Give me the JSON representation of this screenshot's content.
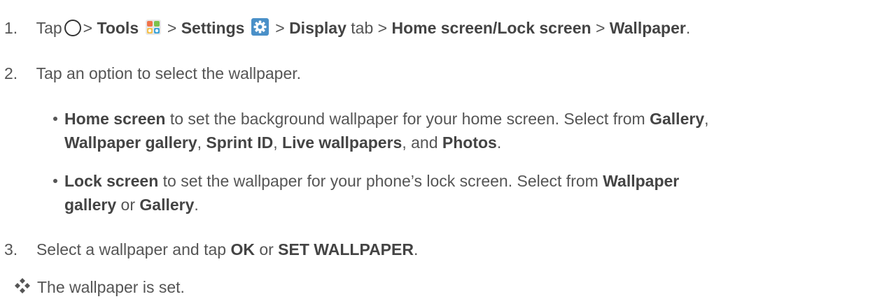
{
  "steps": [
    {
      "number": "1.",
      "parts": {
        "tap": "Tap",
        "sep1": ">",
        "tools": "Tools",
        "sep2": ">",
        "settings": "Settings",
        "sep3": ">",
        "display": "Display",
        "tab": "tab >",
        "home_lock": "Home screen/Lock screen",
        "sep4": ">",
        "wallpaper": "Wallpaper",
        "end": "."
      },
      "icons": [
        "home-circle-icon",
        "tools-folder-icon",
        "settings-gear-icon"
      ]
    },
    {
      "number": "2.",
      "text": "Tap an option to select the wallpaper."
    },
    {
      "number": "3.",
      "parts": {
        "a": "Select a wallpaper and tap",
        "ok": "OK",
        "or": "or",
        "set": "SET WALLPAPER",
        "end": "."
      }
    }
  ],
  "bullets": [
    {
      "line1": {
        "b1": "Home screen",
        "t1": "to set the background wallpaper for your home screen. Select from",
        "b2": "Gallery",
        "t2": ","
      },
      "line2": {
        "b1": "Wallpaper gallery",
        "t1": ",",
        "b2": "Sprint ID",
        "t2": ",",
        "b3": "Live wallpapers",
        "t3": ", and",
        "b4": "Photos",
        "t4": "."
      }
    },
    {
      "line1": {
        "b1": "Lock screen",
        "t1": "to set the wallpaper for your phone’s lock screen. Select from",
        "b2": "Wallpaper"
      },
      "line2": {
        "b1": "gallery",
        "t1": "or",
        "b2": "Gallery",
        "t2": "."
      }
    }
  ],
  "result": {
    "icon": "four-diamond-icon",
    "text": "The wallpaper is set."
  },
  "colors": {
    "text": "#555555",
    "bold_text": "#444444",
    "tools_icon_colors": [
      "#f0734a",
      "#3aa3d8",
      "#f5c04a",
      "#7cc24d"
    ],
    "settings_icon_color": "#4a90c8"
  }
}
